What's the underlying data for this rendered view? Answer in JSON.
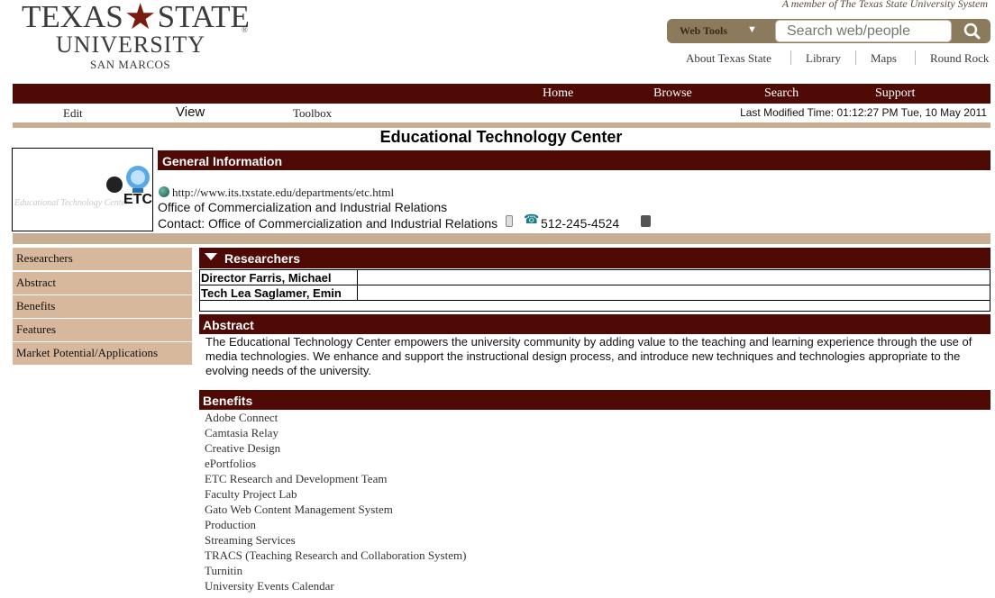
{
  "header": {
    "logo_line1_left": "TEXAS",
    "logo_line1_right": "STATE",
    "logo_line2": "UNIVERSITY",
    "logo_line3": "SAN MARCOS",
    "logo_reg": "®",
    "member_tag": "A member of The Texas State University System",
    "webtools_label": "Web Tools",
    "search_placeholder": "Search web/people",
    "top_links": [
      "About Texas State",
      "Library",
      "Maps",
      "Round Rock"
    ]
  },
  "nav": {
    "items": [
      "Home",
      "Browse",
      "Search",
      "Support"
    ]
  },
  "toolbar": {
    "edit": "Edit",
    "view": "View",
    "toolbox": "Toolbox",
    "last_modified": "Last Modified Time: 01:12:27 PM Tue, 10 May 2011"
  },
  "page_title": "Educational Technology Center",
  "etc_logo": {
    "caption": "Educational Technology Center",
    "abbrev": "ETC"
  },
  "general_info": {
    "title": "General Information",
    "url": "http://www.its.txstate.edu/departments/etc.html",
    "org": "Office of Commercialization and Industrial Relations",
    "contact": "Contact: Office of Commercialization and Industrial Relations",
    "phone": "512-245-4524"
  },
  "sidebar": {
    "items": [
      "Researchers",
      "Abstract",
      "Benefits",
      "Features",
      "Market Potential/Applications"
    ]
  },
  "researchers": {
    "title": "Researchers",
    "rows": [
      {
        "role_name": "Director Farris, Michael",
        "detail": ""
      },
      {
        "role_name": "Tech Lea Saglamer, Emin",
        "detail": ""
      }
    ]
  },
  "abstract": {
    "title": "Abstract",
    "text": "The Educational Technology Center empowers the university community by adding value to the teaching and learning experience through the use of media technologies. We enhance and support the instructional design process, and introduce new techniques and technologies appropriate to the evolving needs of the university."
  },
  "benefits": {
    "title": "Benefits",
    "items": [
      "Adobe Connect",
      "Camtasia Relay",
      "Creative Design",
      "ePortfolios",
      "ETC Research and Development Team",
      "Faculty Project Lab",
      "Gato Web Content Management System",
      "Production",
      "Streaming Services",
      "TRACS (Teaching Research and Collaboration System)",
      "Turnitin",
      "University Events Calendar"
    ]
  },
  "colors": {
    "maroon": "#500a06",
    "tan": "#c7ae92",
    "sidebar_tan": "#d7b89c"
  }
}
